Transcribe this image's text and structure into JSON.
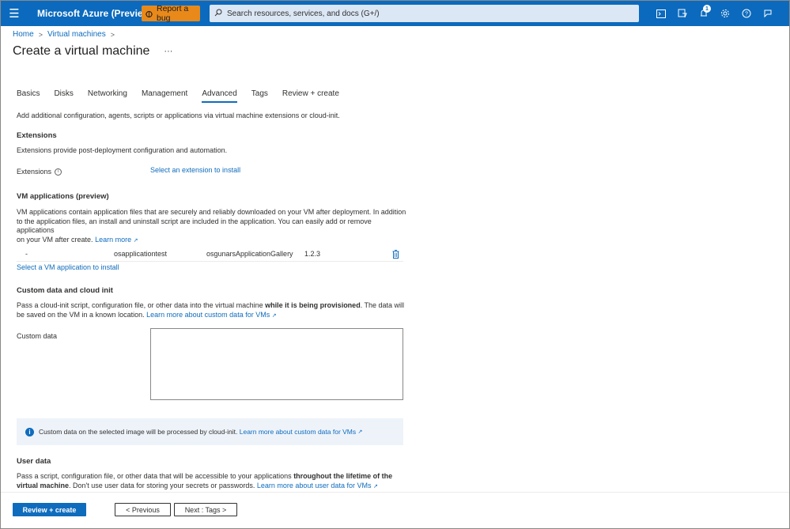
{
  "topbar": {
    "brand": "Microsoft Azure (Preview)",
    "bug_label": "Report a bug",
    "search_placeholder": "Search resources, services, and docs (G+/)",
    "notification_count": "1",
    "icons": [
      "cloud-shell-icon",
      "directory-filter-icon",
      "notifications-icon",
      "settings-icon",
      "help-icon",
      "feedback-icon"
    ]
  },
  "breadcrumb": {
    "home": "Home",
    "vms": "Virtual machines"
  },
  "page": {
    "title": "Create a virtual machine",
    "more": "···"
  },
  "tabs": [
    {
      "label": "Basics"
    },
    {
      "label": "Disks"
    },
    {
      "label": "Networking"
    },
    {
      "label": "Management"
    },
    {
      "label": "Advanced"
    },
    {
      "label": "Tags"
    },
    {
      "label": "Review + create"
    }
  ],
  "content": {
    "intro": "Add additional configuration, agents, scripts or applications via virtual machine extensions or cloud-init.",
    "extensions": {
      "heading": "Extensions",
      "desc": "Extensions provide post-deployment configuration and automation.",
      "label": "Extensions",
      "link": "Select an extension to install"
    },
    "vmapps": {
      "heading": "VM applications (preview)",
      "desc_line1": "VM applications contain application files that are securely and reliably downloaded on your VM after deployment. In addition",
      "desc_line2": "to the application files, an install and uninstall script are included in the application. You can easily add or remove applications",
      "desc_line3": "on your VM after create.",
      "learn_more": "Learn more",
      "row": {
        "dash": "-",
        "name": "osapplicationtest",
        "gallery": "osgunarsApplicationGallery",
        "version": "1.2.3"
      },
      "select_link": "Select a VM application to install"
    },
    "customdata": {
      "heading": "Custom data and cloud init",
      "desc_pre": "Pass a cloud-init script, configuration file, or other data into the virtual machine ",
      "desc_bold": "while it is being provisioned",
      "desc_post": ". The data will",
      "desc_line2": "be saved on the VM in a known location.",
      "learn_more": "Learn more about custom data for VMs",
      "label": "Custom data",
      "value": "",
      "info_text": "Custom data on the selected image will be processed by cloud-init.",
      "info_link": "Learn more about custom data for VMs"
    },
    "userdata": {
      "heading": "User data",
      "desc_pre": "Pass a script, configuration file, or other data that will be accessible to your applications ",
      "desc_bold1": "throughout the lifetime of the",
      "desc_bold2": "virtual machine",
      "desc_post": ". Don't use user data for storing your secrets or passwords.",
      "learn_more": "Learn more about user data for VMs"
    }
  },
  "footer": {
    "review": "Review + create",
    "previous": "< Previous",
    "next": "Next : Tags >"
  }
}
